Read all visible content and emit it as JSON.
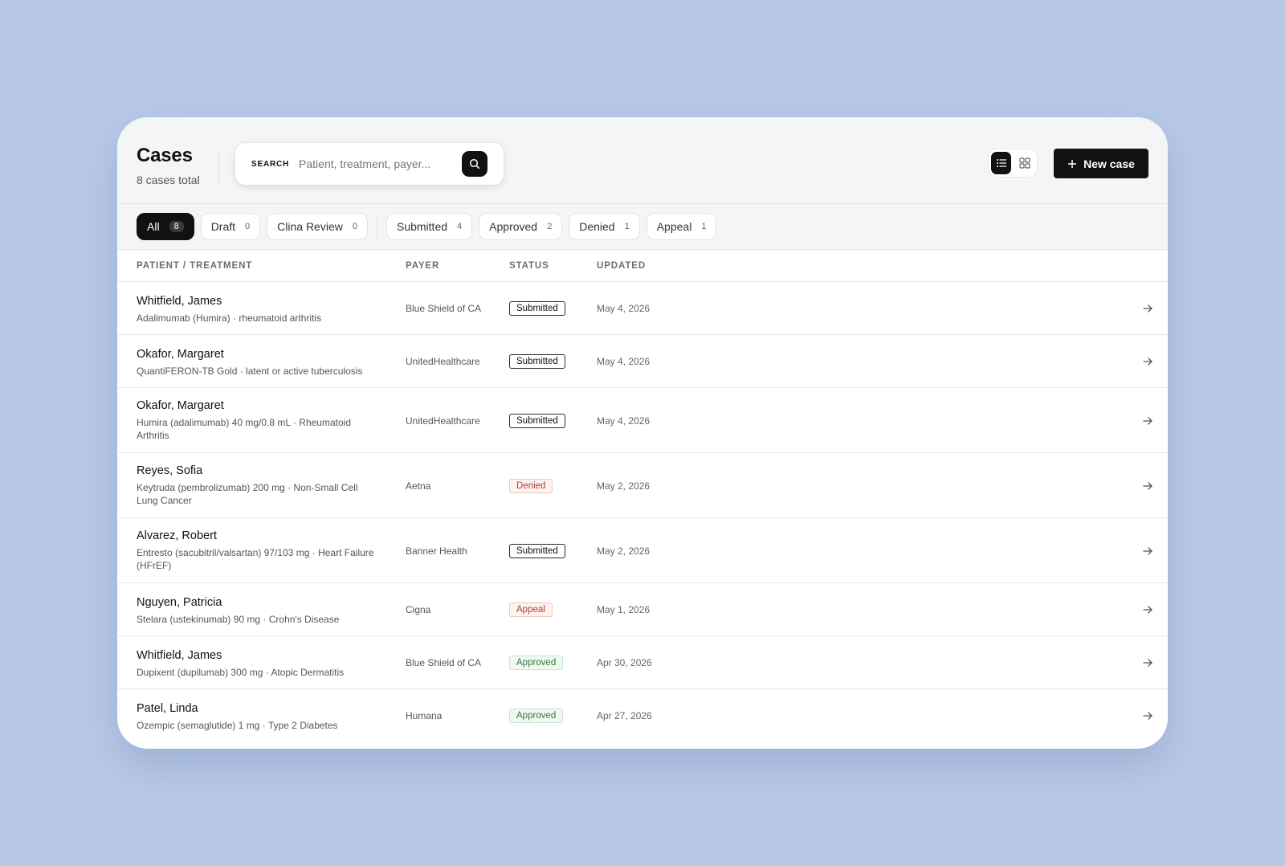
{
  "header": {
    "title": "Cases",
    "subtitle": "8 cases total",
    "search_label": "SEARCH",
    "search_placeholder": "Patient, treatment, payer...",
    "new_case_label": "New case"
  },
  "filters": [
    {
      "label": "All",
      "count": "8",
      "active": true
    },
    {
      "label": "Draft",
      "count": "0"
    },
    {
      "label": "Clina Review",
      "count": "0"
    },
    {
      "label": "Submitted",
      "count": "4"
    },
    {
      "label": "Approved",
      "count": "2"
    },
    {
      "label": "Denied",
      "count": "1"
    },
    {
      "label": "Appeal",
      "count": "1"
    }
  ],
  "columns": {
    "patient": "PATIENT / TREATMENT",
    "payer": "PAYER",
    "status": "STATUS",
    "updated": "UPDATED"
  },
  "rows": [
    {
      "name": "Whitfield, James",
      "treatment": "Adalimumab (Humira) · rheumatoid arthritis",
      "payer": "Blue Shield of CA",
      "status": "Submitted",
      "status_kind": "submitted",
      "updated": "May 4, 2026"
    },
    {
      "name": "Okafor, Margaret",
      "treatment": "QuantiFERON-TB Gold · latent or active tuberculosis",
      "payer": "UnitedHealthcare",
      "status": "Submitted",
      "status_kind": "submitted",
      "updated": "May 4, 2026"
    },
    {
      "name": "Okafor, Margaret",
      "treatment": "Humira (adalimumab) 40 mg/0.8 mL · Rheumatoid Arthritis",
      "payer": "UnitedHealthcare",
      "status": "Submitted",
      "status_kind": "submitted",
      "updated": "May 4, 2026"
    },
    {
      "name": "Reyes, Sofia",
      "treatment": "Keytruda (pembrolizumab) 200 mg · Non-Small Cell Lung Cancer",
      "payer": "Aetna",
      "status": "Denied",
      "status_kind": "denied",
      "updated": "May 2, 2026"
    },
    {
      "name": "Alvarez, Robert",
      "treatment": "Entresto (sacubitril/valsartan) 97/103 mg · Heart Failure (HFrEF)",
      "payer": "Banner Health",
      "status": "Submitted",
      "status_kind": "submitted",
      "updated": "May 2, 2026"
    },
    {
      "name": "Nguyen, Patricia",
      "treatment": "Stelara (ustekinumab) 90 mg · Crohn's Disease",
      "payer": "Cigna",
      "status": "Appeal",
      "status_kind": "appeal",
      "updated": "May 1, 2026"
    },
    {
      "name": "Whitfield, James",
      "treatment": "Dupixent (dupilumab) 300 mg · Atopic Dermatitis",
      "payer": "Blue Shield of CA",
      "status": "Approved",
      "status_kind": "approved",
      "updated": "Apr 30, 2026"
    },
    {
      "name": "Patel, Linda",
      "treatment": "Ozempic (semaglutide) 1 mg · Type 2 Diabetes",
      "payer": "Humana",
      "status": "Approved",
      "status_kind": "approved",
      "updated": "Apr 27, 2026"
    }
  ]
}
